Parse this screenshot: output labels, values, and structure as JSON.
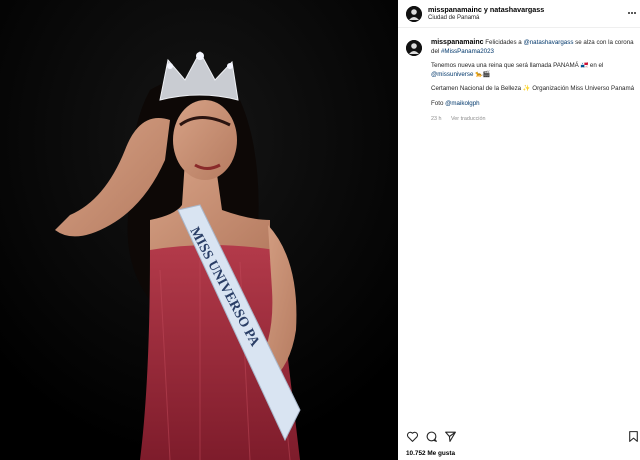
{
  "header": {
    "names": "misspanamainc y natashavargass",
    "location": "Ciudad de Panamá"
  },
  "caption": {
    "username": "misspanamainc",
    "line1_text": "Felicidades a ",
    "line1_mention": "@natashavargass",
    "line1_text2": " se alza con la corona del ",
    "line1_hashtag": "#MissPanama2023",
    "para2_text": "Tenemos nueva una reina que será llamada PANAMÁ 🇵🇦 en el ",
    "para2_mention": "@missuniverse",
    "para2_emoji": " 🐆🎬",
    "para3": "Certamen Nacional de la Belleza ✨ Organización Miss Universo Panamá",
    "para4_text": "Foto ",
    "para4_mention": "@maikolgph",
    "age": "23 h",
    "translate": "Ver traducción"
  },
  "actions": {
    "like_icon": "heart-icon",
    "comment_icon": "comment-icon",
    "share_icon": "share-icon",
    "save_icon": "bookmark-icon"
  },
  "likes": "10.752 Me gusta",
  "sash_text": "MISS UNIVERSO PA",
  "colors": {
    "photo_bg": "#000000",
    "dress": "#9b2436",
    "sash": "#d9e4f2"
  }
}
